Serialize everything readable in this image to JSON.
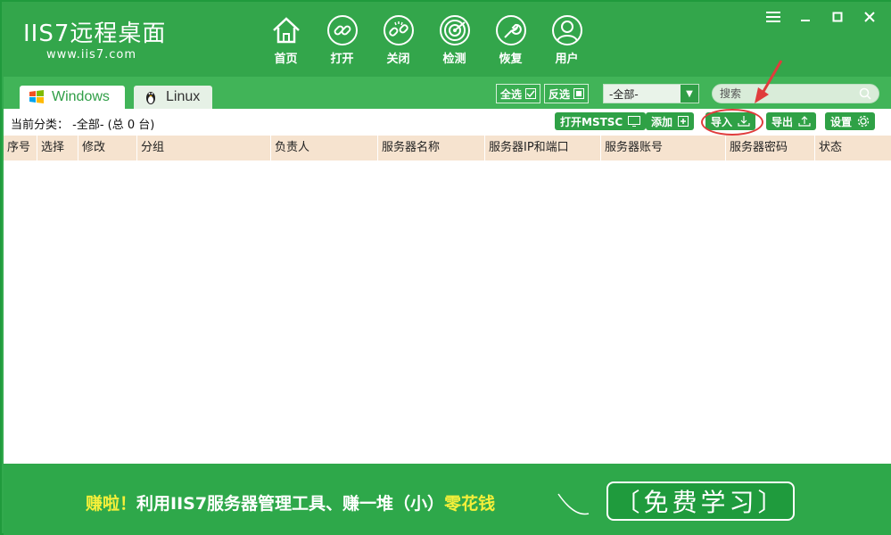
{
  "app": {
    "logo_title": "IIS7远程桌面",
    "logo_url": "www.iis7.com"
  },
  "nav": [
    {
      "label": "首页",
      "icon": "home-icon"
    },
    {
      "label": "打开",
      "icon": "link-icon"
    },
    {
      "label": "关闭",
      "icon": "broken-link-icon"
    },
    {
      "label": "检测",
      "icon": "radar-icon"
    },
    {
      "label": "恢复",
      "icon": "wrench-icon"
    },
    {
      "label": "用户",
      "icon": "user-icon"
    }
  ],
  "tabs": [
    {
      "label": "Windows",
      "active": true
    },
    {
      "label": "Linux",
      "active": false
    }
  ],
  "filters": {
    "select_all": "全选",
    "invert_select": "反选",
    "group_dropdown": "-全部-",
    "search_placeholder": "搜索"
  },
  "toolbar": {
    "category_text": "当前分类： -全部- (总 0 台)",
    "open_mstsc": "打开MSTSC",
    "add": "添加",
    "import": "导入",
    "export": "导出",
    "settings": "设置"
  },
  "table": {
    "columns": [
      "序号",
      "选择",
      "修改",
      "分组",
      "负责人",
      "服务器名称",
      "服务器IP和端口",
      "服务器账号",
      "服务器密码",
      "状态"
    ],
    "rows": []
  },
  "banner": {
    "lead": "赚啦！",
    "middle": "利用IIS7服务器管理工具、赚一堆（小）",
    "highlight": "零花钱",
    "button": "〔免费学习〕"
  },
  "colors": {
    "brand_green": "#33a64b",
    "header_row": "#f6e3cf",
    "highlight_red": "#e03c3c"
  }
}
